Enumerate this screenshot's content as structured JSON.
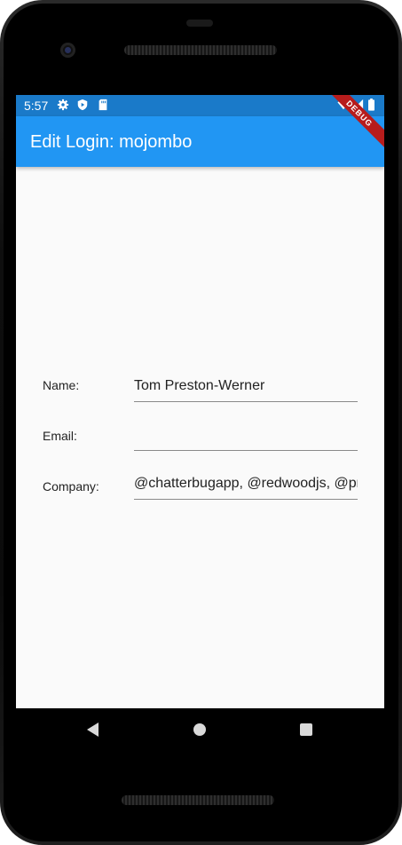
{
  "status_bar": {
    "time": "5:57",
    "icons_left": [
      "settings-icon",
      "play-protect-icon",
      "sd-card-icon"
    ],
    "icons_right": [
      "wifi-icon",
      "signal-icon",
      "battery-icon"
    ]
  },
  "app_bar": {
    "title": "Edit Login: mojombo",
    "background_color": "#2196f3",
    "debug_banner": "DEBUG"
  },
  "form": {
    "name": {
      "label": "Name:",
      "value": "Tom Preston-Werner"
    },
    "email": {
      "label": "Email:",
      "value": ""
    },
    "company": {
      "label": "Company:",
      "value": "@chatterbugapp, @redwoodjs, @preston"
    }
  },
  "nav_bar": {
    "buttons": [
      "back-icon",
      "home-icon",
      "recent-apps-icon"
    ]
  }
}
